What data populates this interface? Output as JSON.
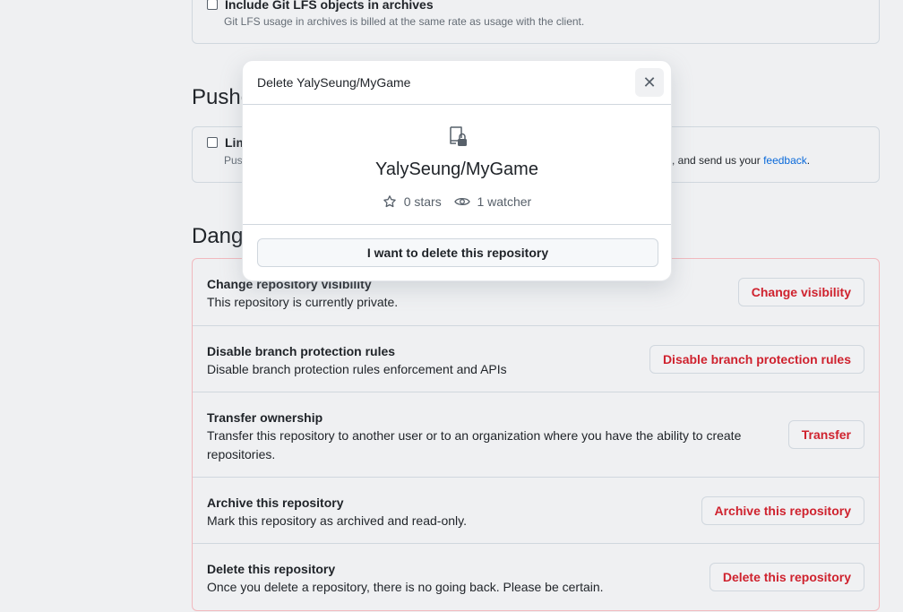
{
  "lfs": {
    "label": "Include Git LFS objects in archives",
    "note": "Git LFS usage in archives is billed at the same rate as usage with the client."
  },
  "pushes": {
    "heading_visible": "Pushe",
    "limit_label_visible": "Lim",
    "note_start_visible": "Pus",
    "note_end": ", and send us your ",
    "feedback_link": "feedback",
    "feedback_tail": "."
  },
  "danger": {
    "heading_visible": "Dang",
    "rows": [
      {
        "title": "Change repository visibility",
        "desc": "This repository is currently private.",
        "button": "Change visibility"
      },
      {
        "title": "Disable branch protection rules",
        "desc": "Disable branch protection rules enforcement and APIs",
        "button": "Disable branch protection rules"
      },
      {
        "title": "Transfer ownership",
        "desc": "Transfer this repository to another user or to an organization where you have the ability to create repositories.",
        "button": "Transfer"
      },
      {
        "title": "Archive this repository",
        "desc": "Mark this repository as archived and read-only.",
        "button": "Archive this repository"
      },
      {
        "title": "Delete this repository",
        "desc": "Once you delete a repository, there is no going back. Please be certain.",
        "button": "Delete this repository"
      }
    ]
  },
  "modal": {
    "title": "Delete YalySeung/MyGame",
    "close_glyph": "✕",
    "repo_name": "YalySeung/MyGame",
    "stars": "0 stars",
    "watchers": "1 watcher",
    "confirm_button": "I want to delete this repository"
  },
  "colors": {
    "danger": "#cf222e",
    "link": "#0969da",
    "border": "#d0d7de"
  }
}
